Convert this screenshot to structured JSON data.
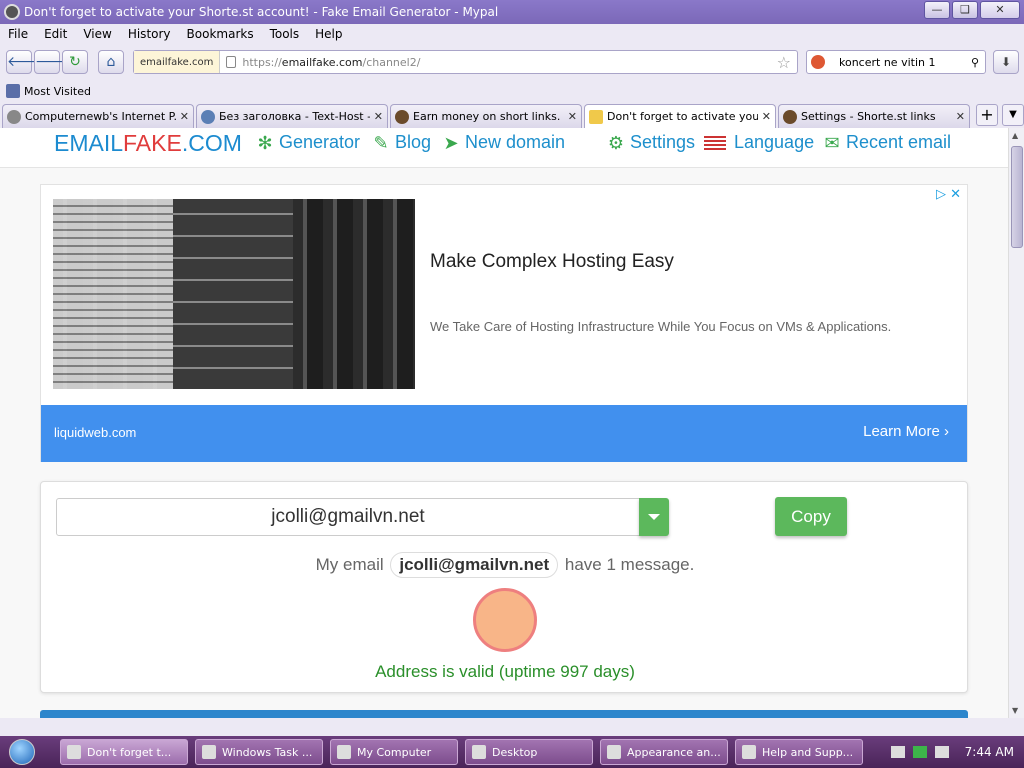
{
  "window": {
    "title": "Don't forget to activate your Shorte.st account! - Fake Email Generator - Mypal"
  },
  "menu": [
    "File",
    "Edit",
    "View",
    "History",
    "Bookmarks",
    "Tools",
    "Help"
  ],
  "address": {
    "site_label": "emailfake.com",
    "url_prefix": "https://",
    "url_host": "emailfake.com",
    "url_path": "/channel2/"
  },
  "search": {
    "value": "koncert ne vitin 1"
  },
  "bookmarks": {
    "most_visited": "Most Visited"
  },
  "tabs": [
    {
      "label": "Computernewb's Internet P...",
      "active": false
    },
    {
      "label": "Без заголовка - Text-Host - ...",
      "active": false
    },
    {
      "label": "Earn money on short links. ...",
      "active": false
    },
    {
      "label": "Don't forget to activate you...",
      "active": true
    },
    {
      "label": "Settings - Shorte.st links",
      "active": false
    }
  ],
  "site": {
    "brand_a": "EMAIL",
    "brand_b": "FAKE",
    "brand_c": ".COM",
    "nav": {
      "generator": "Generator",
      "blog": "Blog",
      "new_domain": "New domain",
      "settings": "Settings",
      "language": "Language",
      "recent_email": "Recent email"
    }
  },
  "ad": {
    "headline": "Make Complex Hosting Easy",
    "description": "We Take Care of Hosting Infrastructure While You Focus on VMs & Applications.",
    "domain": "liquidweb.com",
    "cta": "Learn More"
  },
  "email": {
    "address": "jcolli@gmailvn.net",
    "copy_label": "Copy",
    "msg_prefix": "My email",
    "msg_address": "jcolli@gmailvn.net",
    "msg_suffix": "have 1 message.",
    "status": "Address is valid (uptime 997 days)"
  },
  "taskbar": {
    "items": [
      "Don't forget t...",
      "Windows Task ...",
      "My Computer",
      "Desktop",
      "Appearance an...",
      "Help and Supp..."
    ],
    "clock": "7:44 AM"
  },
  "colors": {
    "brand_blue": "#1c8bd0",
    "brand_red": "#e03c3c",
    "success": "#5cb85c",
    "valid_text": "#2a8f2a",
    "ad_footer": "#4190ee"
  }
}
